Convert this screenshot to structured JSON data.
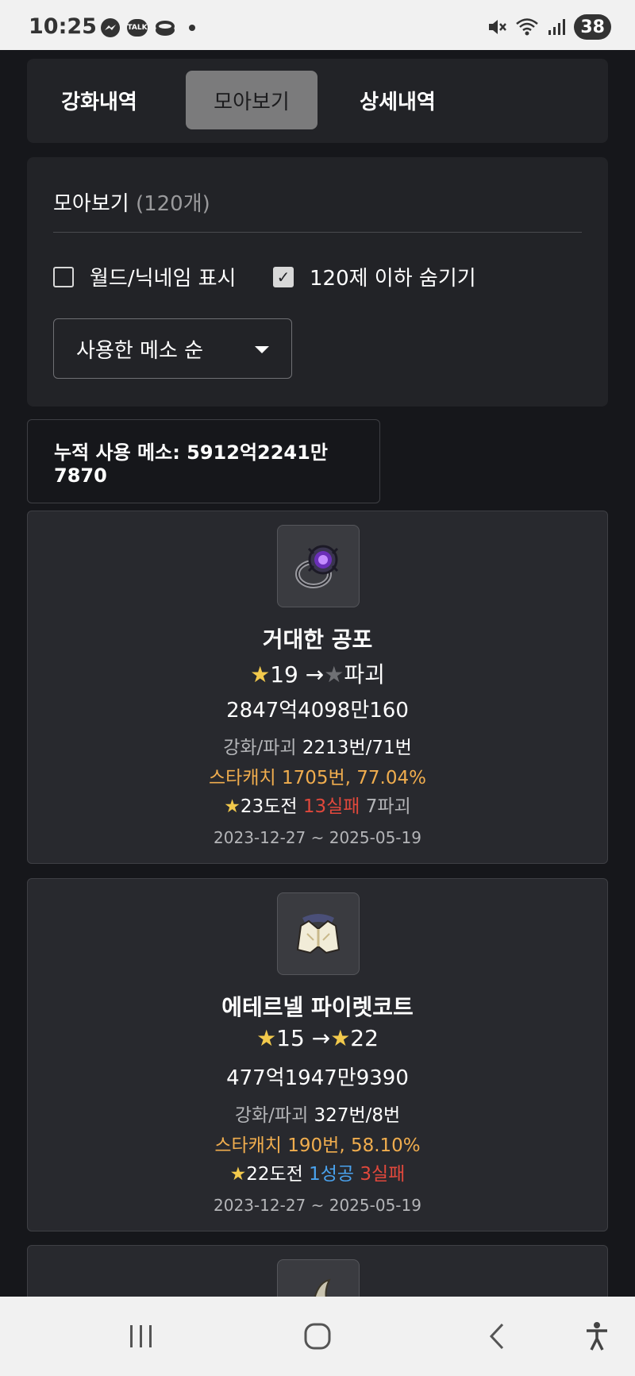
{
  "status_bar": {
    "time": "10:25",
    "left_icons": [
      "messenger-icon",
      "kakaotalk-icon",
      "coin-icon",
      "dot-icon"
    ],
    "kakaotalk_label": "TALK",
    "right_icons": [
      "mute-icon",
      "wifi-icon",
      "signal-icon"
    ],
    "battery": "38"
  },
  "tabs": [
    {
      "label": "강화내역",
      "active": false
    },
    {
      "label": "모아보기",
      "active": true
    },
    {
      "label": "상세내역",
      "active": false
    }
  ],
  "settings": {
    "title": "모아보기",
    "count": "(120개)",
    "option_world": {
      "label": "월드/닉네임 표시",
      "checked": false
    },
    "option_hide": {
      "label": "120제 이하 숨기기",
      "checked": true
    },
    "sort_select": "사용한 메소 순"
  },
  "total": {
    "label": "누적 사용 메소: 5912억2241만7870"
  },
  "items": [
    {
      "icon": "dark-ring-icon",
      "name": "거대한 공포",
      "from_star": "19",
      "arrow": "→",
      "to_text": "파괴",
      "meso": "2847억4098만160",
      "enh_label": "강화/파괴",
      "enh_value": "2213번/71번",
      "starcatch": "스타캐치 1705번, 77.04%",
      "challenge": "23도전",
      "fail": "13실패",
      "destroy": "7파괴",
      "date": "2023-12-27 ~ 2025-05-19"
    },
    {
      "icon": "white-coat-icon",
      "name": "에테르넬 파이렛코트",
      "from_star": "15",
      "arrow": "→",
      "to_star": "22",
      "meso": "477억1947만9390",
      "enh_label": "강화/파괴",
      "enh_value": "327번/8번",
      "starcatch": "스타캐치 190번, 58.10%",
      "challenge": "22도전",
      "success": "1성공",
      "fail": "3실패",
      "date": "2023-12-27 ~ 2025-05-19"
    }
  ],
  "nav": {
    "buttons": [
      "recent-apps-icon",
      "home-icon",
      "back-icon",
      "accessibility-icon"
    ]
  },
  "colors": {
    "background": "#16171b",
    "card": "#222327",
    "active_tab": "#7b7b7c",
    "star": "#f2c94c",
    "starcatch": "#f0ad4e",
    "fail": "#e0483c",
    "success": "#4aa3ef"
  }
}
